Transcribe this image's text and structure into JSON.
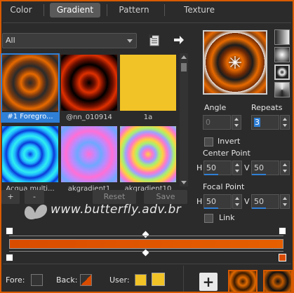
{
  "tabs": [
    {
      "label": "Color",
      "active": false
    },
    {
      "label": "Gradient",
      "active": true
    },
    {
      "label": "Pattern",
      "active": false
    },
    {
      "label": "Texture",
      "active": false
    }
  ],
  "filter": {
    "value": "All"
  },
  "gradients": [
    {
      "label": "#1 Foregro..."
    },
    {
      "label": "@nn_010914"
    },
    {
      "label": "1a"
    },
    {
      "label": "Acqua multi..."
    },
    {
      "label": "akgradient1"
    },
    {
      "label": "akgradient10"
    }
  ],
  "library_buttons": {
    "add": "+",
    "remove": "-",
    "reset": "Reset",
    "save": "Save"
  },
  "controls": {
    "angle_label": "Angle",
    "angle_value": "0",
    "repeats_label": "Repeats",
    "repeats_value": "3",
    "invert_label": "Invert",
    "center_point_label": "Center Point",
    "center_h": "50",
    "center_v": "50",
    "focal_point_label": "Focal Point",
    "focal_h": "50",
    "focal_v": "50",
    "h_label": "H",
    "v_label": "V",
    "link_label": "Link"
  },
  "watermark": "www.butterfly.adv.br",
  "bottom": {
    "fore_label": "Fore:",
    "back_label": "Back:",
    "user_label": "User:",
    "add_button": "+"
  },
  "colors": {
    "frame": "#d95a00",
    "gradient_start": "#d84c00",
    "gradient_end": "#e65f00",
    "user_swatch": "#f2c326",
    "selection": "#2f7fd6"
  }
}
